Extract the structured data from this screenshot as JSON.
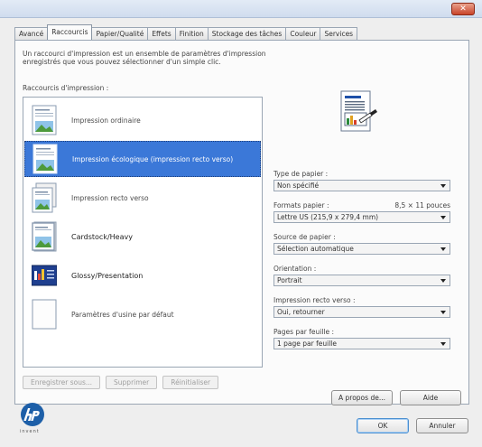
{
  "window": {
    "title": "",
    "close_label": "✕"
  },
  "tabs": [
    {
      "label": "Avancé"
    },
    {
      "label": "Raccourcis"
    },
    {
      "label": "Papier/Qualité"
    },
    {
      "label": "Effets"
    },
    {
      "label": "Finition"
    },
    {
      "label": "Stockage des tâches"
    },
    {
      "label": "Couleur"
    },
    {
      "label": "Services"
    }
  ],
  "shortcuts": {
    "description": "Un raccourci d'impression est un ensemble de paramètres d'impression enregistrés que vous pouvez sélectionner d'un simple clic.",
    "list_label": "Raccourcis d'impression :",
    "items": [
      {
        "label": "Impression ordinaire",
        "icon": "page-landscape-icon"
      },
      {
        "label": "Impression écologique (impression recto verso)",
        "icon": "page-landscape-icon"
      },
      {
        "label": "Impression recto verso",
        "icon": "duplex-page-icon"
      },
      {
        "label": "Cardstock/Heavy",
        "icon": "cardstock-page-icon"
      },
      {
        "label": "Glossy/Presentation",
        "icon": "presentation-slide-icon"
      },
      {
        "label": "Paramètres d'usine par défaut",
        "icon": "blank-page-icon"
      }
    ],
    "selected_index": 1,
    "buttons": {
      "save": "Enregistrer sous...",
      "delete": "Supprimer",
      "reset": "Réinitialiser"
    }
  },
  "settings": {
    "paper_type": {
      "label": "Type de papier :",
      "value": "Non spécifié"
    },
    "paper_size": {
      "label": "Formats papier :",
      "extra": "8,5 × 11 pouces",
      "value": "Lettre US (215,9 x 279,4 mm)"
    },
    "paper_source": {
      "label": "Source de papier :",
      "value": "Sélection automatique"
    },
    "orientation": {
      "label": "Orientation :",
      "value": "Portrait"
    },
    "duplex": {
      "label": "Impression recto verso :",
      "value": "Oui, retourner"
    },
    "pages_per_sheet": {
      "label": "Pages par feuille :",
      "value": "1 page par feuille"
    }
  },
  "footer": {
    "brand_sub": "invent",
    "about_label": "A propos de...",
    "help_label": "Aide",
    "ok_label": "OK",
    "cancel_label": "Annuler"
  },
  "colors": {
    "accent_selection": "#3b78d8",
    "close_button": "#c9442a",
    "hp_blue": "#1d5fa8"
  }
}
